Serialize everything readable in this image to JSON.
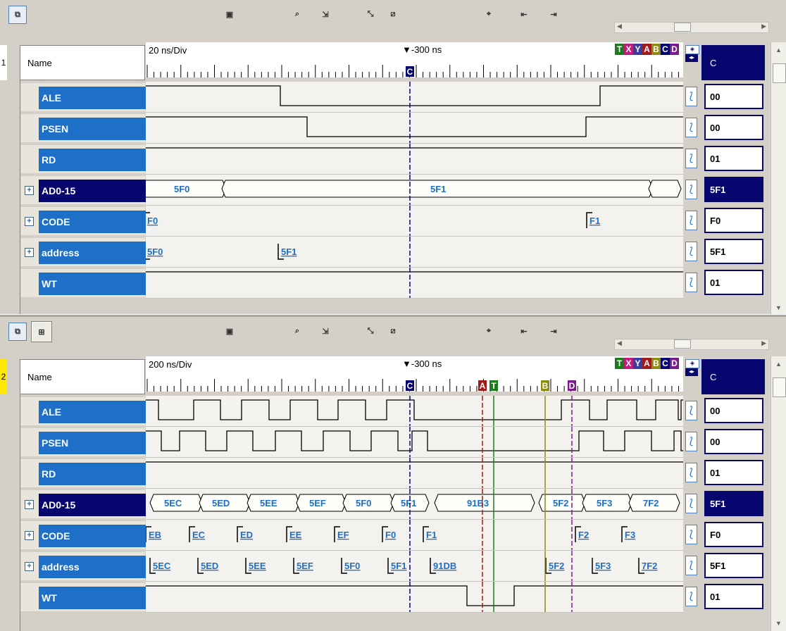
{
  "panes": [
    {
      "line_number": "1",
      "name_header": "Name",
      "scale": "20 ns/Div",
      "cursor_time": "-300 ns",
      "column_header": "C",
      "markers": [
        {
          "label": "C",
          "color": "#06066e"
        }
      ],
      "signals": [
        {
          "name": "ALE",
          "expand": "",
          "value": "00",
          "selected": false
        },
        {
          "name": "PSEN",
          "expand": "",
          "value": "00",
          "selected": false
        },
        {
          "name": "RD",
          "expand": "",
          "value": "01",
          "selected": false
        },
        {
          "name": "AD0-15",
          "expand": "+",
          "value": "5F1",
          "selected": true
        },
        {
          "name": "CODE",
          "expand": "+",
          "value": "F0",
          "selected": false
        },
        {
          "name": "address",
          "expand": "+",
          "value": "5F1",
          "selected": false
        },
        {
          "name": "WT",
          "expand": "",
          "value": "01",
          "selected": false
        }
      ],
      "bus_labels": {
        "AD0-15": [
          "5F0",
          "5F1"
        ],
        "CODE": [
          "F0",
          "F1"
        ],
        "address": [
          "5F0",
          "5F1"
        ]
      }
    },
    {
      "line_number": "2",
      "name_header": "Name",
      "scale": "200 ns/Div",
      "cursor_time": "-300 ns",
      "column_header": "C",
      "markers": [
        {
          "label": "C",
          "color": "#06066e"
        },
        {
          "label": "A",
          "color": "#9c1c1c"
        },
        {
          "label": "T",
          "color": "#1c7c1c"
        },
        {
          "label": "B",
          "color": "#8c8c10"
        },
        {
          "label": "D",
          "color": "#7c1c8c"
        }
      ],
      "signals": [
        {
          "name": "ALE",
          "expand": "",
          "value": "00",
          "selected": false
        },
        {
          "name": "PSEN",
          "expand": "",
          "value": "00",
          "selected": false
        },
        {
          "name": "RD",
          "expand": "",
          "value": "01",
          "selected": false
        },
        {
          "name": "AD0-15",
          "expand": "+",
          "value": "5F1",
          "selected": true
        },
        {
          "name": "CODE",
          "expand": "+",
          "value": "F0",
          "selected": false
        },
        {
          "name": "address",
          "expand": "+",
          "value": "5F1",
          "selected": false
        },
        {
          "name": "WT",
          "expand": "",
          "value": "01",
          "selected": false
        }
      ],
      "bus_labels": {
        "AD0-15": [
          "5EC",
          "5ED",
          "5EE",
          "5EF",
          "5F0",
          "5F1",
          "91B3",
          "5F2",
          "5F3",
          "7F2"
        ],
        "CODE": [
          "EB",
          "EC",
          "ED",
          "EE",
          "EF",
          "F0",
          "F1",
          "F2",
          "F3"
        ],
        "address": [
          "5EC",
          "5ED",
          "5EE",
          "5EF",
          "5F0",
          "5F1",
          "91DB",
          "5F2",
          "5F3",
          "7F2"
        ]
      }
    }
  ],
  "letter_bar": [
    "T",
    "X",
    "Y",
    "A",
    "B",
    "C",
    "D"
  ],
  "letter_colors": [
    "#1c7c1c",
    "#c01c7c",
    "#3c3c9c",
    "#9c1c1c",
    "#8c8c10",
    "#06066e",
    "#7c1c8c"
  ]
}
